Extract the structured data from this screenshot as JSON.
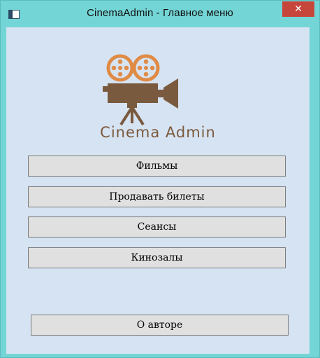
{
  "window": {
    "title": "CinemaAdmin - Главное меню",
    "close_glyph": "✕"
  },
  "logo": {
    "brand_text": "Cinema Admin",
    "icon": "movie-camera-icon",
    "colors": {
      "reels": "#e08b45",
      "body": "#7a5a3e",
      "brand": "#7a5a3e"
    }
  },
  "menu": {
    "films": "Фильмы",
    "sell_tickets": "Продавать билеты",
    "sessions": "Сеансы",
    "halls": "Кинозалы"
  },
  "about": {
    "label": "О авторе"
  },
  "colors": {
    "frame": "#74d5d6",
    "client": "#d6e3f2",
    "button": "#e0e0e0",
    "close": "#c7463c"
  }
}
